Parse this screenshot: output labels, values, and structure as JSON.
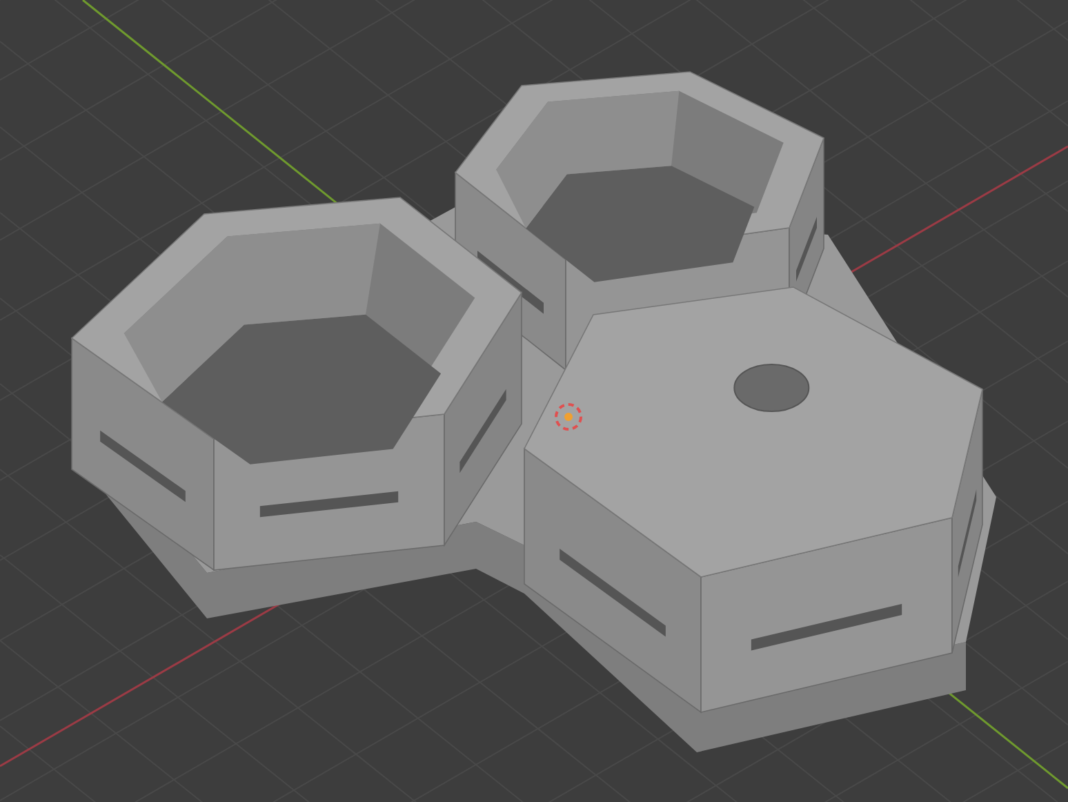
{
  "viewport": {
    "objects": [
      {
        "kind": "open"
      },
      {
        "kind": "open"
      },
      {
        "kind": "closed"
      }
    ]
  }
}
